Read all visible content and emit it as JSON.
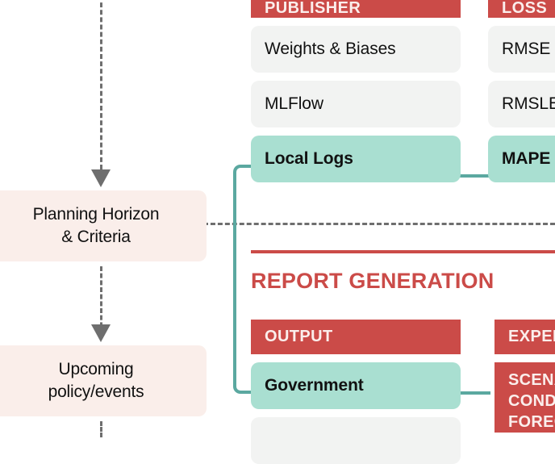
{
  "diagram": {
    "type": "flowchart",
    "colors": {
      "accent_red": "#cb4b48",
      "highlight_teal": "#a9dfd1",
      "connector_teal": "#5ba8a0",
      "flow_box_pink": "#faeeea",
      "cell_gray": "#f2f3f2",
      "dash_gray": "#6e6e6e"
    }
  },
  "flow": {
    "planning": "Planning Horizon\n& Criteria",
    "planning_line1": "Planning Horizon",
    "planning_line2": "& Criteria",
    "upcoming_line1": "Upcoming",
    "upcoming_line2": "policy/events"
  },
  "columns": {
    "publisher": {
      "header": "PUBLISHER",
      "rows": [
        {
          "label": "Weights & Biases",
          "selected": false
        },
        {
          "label": "MLFlow",
          "selected": false
        },
        {
          "label": "Local Logs",
          "selected": true
        }
      ]
    },
    "loss": {
      "header": "LOSS",
      "rows": [
        {
          "label": "RMSE",
          "selected": false
        },
        {
          "label": "RMSLE",
          "selected": false
        },
        {
          "label": "MAPE",
          "selected": true
        }
      ]
    },
    "output": {
      "header": "OUTPUT",
      "rows": [
        {
          "label": "Government",
          "selected": true
        },
        {
          "label": "",
          "selected": false
        }
      ]
    },
    "expert": {
      "header": "EXPERT",
      "rows": [
        {
          "label": "SCENARIO\nCONDITIONAL\nFORECAST",
          "selected": false
        }
      ]
    }
  },
  "section": {
    "report_generation_title": "REPORT GENERATION"
  }
}
